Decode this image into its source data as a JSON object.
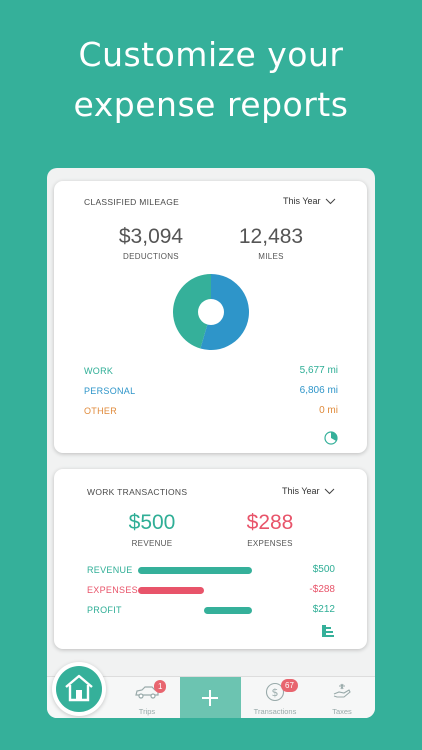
{
  "headline": {
    "line1": "Customize your",
    "line2": "expense reports"
  },
  "colors": {
    "teal": "#35b09a",
    "blue": "#2e95c9",
    "orange": "#e08a3a",
    "red": "#e8546a"
  },
  "mileage": {
    "title": "CLASSIFIED MILEAGE",
    "period": "This Year",
    "deductions_value": "$3,094",
    "deductions_label": "DEDUCTIONS",
    "miles_value": "12,483",
    "miles_label": "MILES",
    "donut": {
      "work_fraction": 0.455,
      "personal_fraction": 0.545,
      "other_fraction": 0
    },
    "rows": [
      {
        "label": "WORK",
        "value": "5,677 mi"
      },
      {
        "label": "PERSONAL",
        "value": "6,806 mi"
      },
      {
        "label": "OTHER",
        "value": "0 mi"
      }
    ],
    "chart_icon": "pie-chart-icon"
  },
  "transactions": {
    "title": "WORK TRANSACTIONS",
    "period": "This Year",
    "revenue_value": "$500",
    "revenue_label": "REVENUE",
    "expenses_value": "$288",
    "expenses_label": "EXPENSES",
    "rows": [
      {
        "label": "REVENUE",
        "value": "$500",
        "amount": 500
      },
      {
        "label": "EXPENSES",
        "value": "-$288",
        "amount": -288
      },
      {
        "label": "PROFIT",
        "value": "$212",
        "amount": 212
      }
    ],
    "chart_icon": "bar-chart-icon"
  },
  "tabbar": {
    "home_icon": "home-icon",
    "trips_label": "Trips",
    "trips_badge": "1",
    "add_icon": "plus-icon",
    "transactions_label": "Transactions",
    "transactions_badge": "67",
    "taxes_label": "Taxes"
  }
}
